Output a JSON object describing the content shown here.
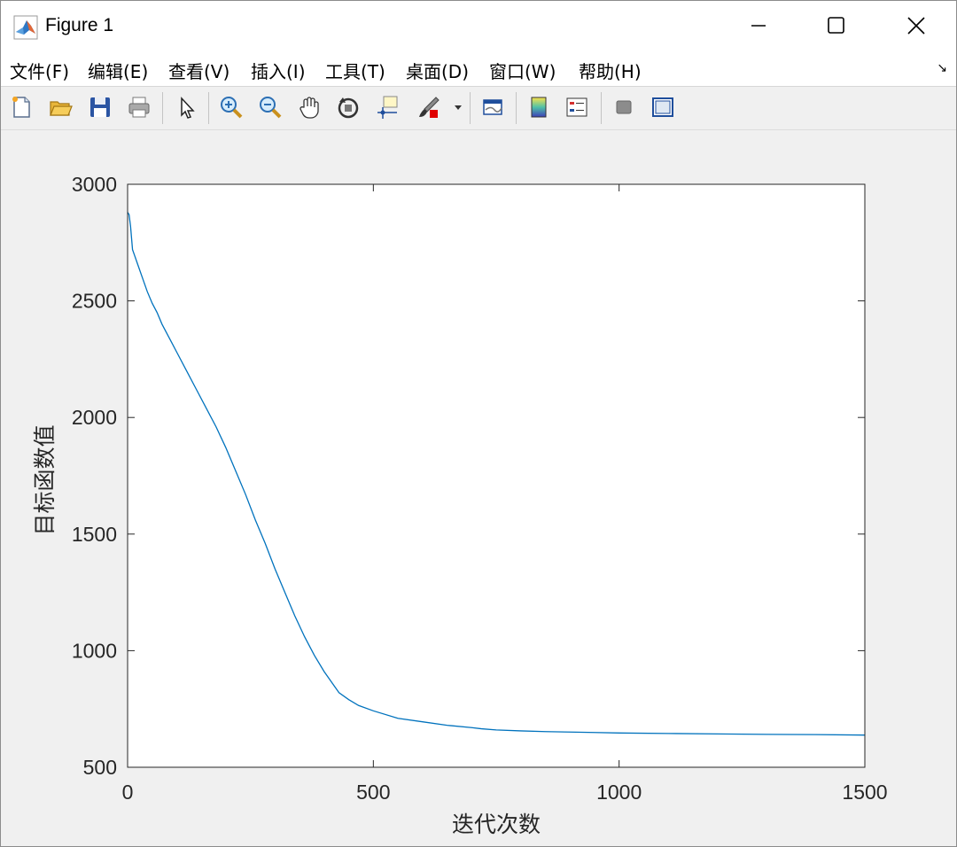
{
  "window": {
    "title": "Figure 1",
    "controls": {
      "minimize": "minimize",
      "maximize": "maximize",
      "close": "close"
    }
  },
  "menubar": {
    "items": [
      "文件(F)",
      "编辑(E)",
      "查看(V)",
      "插入(I)",
      "工具(T)",
      "桌面(D)",
      "窗口(W)",
      "帮助(H)"
    ],
    "overflow_icon": "↘"
  },
  "toolbar": {
    "buttons": [
      "new-figure",
      "open-file",
      "save",
      "print",
      "select-arrow",
      "zoom-in",
      "zoom-out",
      "pan",
      "rotate-3d",
      "data-cursor",
      "brush",
      "link-plot",
      "insert-colorbar",
      "insert-legend",
      "hide-plot-tools",
      "show-plot-tools"
    ]
  },
  "chart_data": {
    "type": "line",
    "title": "",
    "xlabel": "迭代次数",
    "ylabel": "目标函数值",
    "xlim": [
      0,
      1500
    ],
    "ylim": [
      500,
      3000
    ],
    "xticks": [
      0,
      500,
      1000,
      1500
    ],
    "yticks": [
      500,
      1000,
      1500,
      2000,
      2500,
      3000
    ],
    "xtick_labels": [
      "0",
      "500",
      "1000",
      "1500"
    ],
    "ytick_labels": [
      "500",
      "1000",
      "1500",
      "2000",
      "2500",
      "3000"
    ],
    "grid": false,
    "line_color": "#0072BD",
    "series": [
      {
        "x": [
          0,
          3,
          6,
          10,
          15,
          20,
          30,
          40,
          50,
          60,
          70,
          80,
          90,
          100,
          120,
          140,
          160,
          180,
          200,
          220,
          240,
          260,
          280,
          300,
          320,
          340,
          360,
          380,
          400,
          420,
          430,
          450,
          470,
          500,
          550,
          600,
          650,
          700,
          720,
          750,
          800,
          850,
          900,
          950,
          1000,
          1100,
          1200,
          1300,
          1400,
          1500
        ],
        "y": [
          2880,
          2870,
          2820,
          2720,
          2690,
          2660,
          2600,
          2540,
          2490,
          2450,
          2400,
          2360,
          2320,
          2280,
          2200,
          2120,
          2040,
          1960,
          1870,
          1770,
          1670,
          1560,
          1460,
          1350,
          1250,
          1150,
          1060,
          980,
          910,
          850,
          820,
          790,
          765,
          742,
          710,
          695,
          680,
          670,
          665,
          660,
          656,
          653,
          651,
          649,
          647,
          645,
          643,
          641,
          640,
          638
        ]
      }
    ]
  }
}
